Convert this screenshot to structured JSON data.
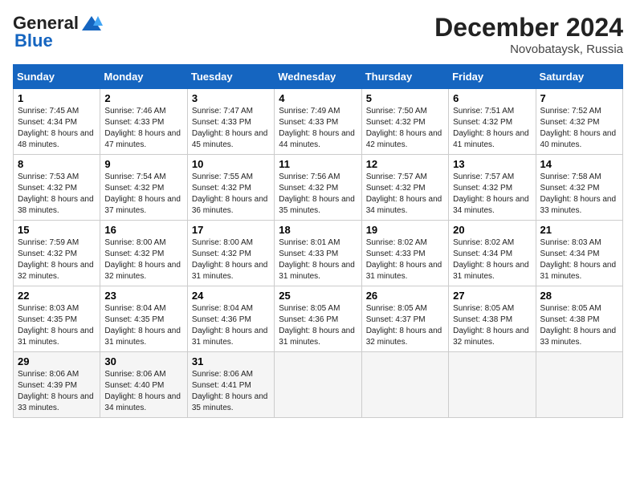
{
  "header": {
    "logo_general": "General",
    "logo_blue": "Blue",
    "month_title": "December 2024",
    "location": "Novobataysk, Russia"
  },
  "weekdays": [
    "Sunday",
    "Monday",
    "Tuesday",
    "Wednesday",
    "Thursday",
    "Friday",
    "Saturday"
  ],
  "weeks": [
    [
      {
        "day": "1",
        "sunrise": "Sunrise: 7:45 AM",
        "sunset": "Sunset: 4:34 PM",
        "daylight": "Daylight: 8 hours and 48 minutes."
      },
      {
        "day": "2",
        "sunrise": "Sunrise: 7:46 AM",
        "sunset": "Sunset: 4:33 PM",
        "daylight": "Daylight: 8 hours and 47 minutes."
      },
      {
        "day": "3",
        "sunrise": "Sunrise: 7:47 AM",
        "sunset": "Sunset: 4:33 PM",
        "daylight": "Daylight: 8 hours and 45 minutes."
      },
      {
        "day": "4",
        "sunrise": "Sunrise: 7:49 AM",
        "sunset": "Sunset: 4:33 PM",
        "daylight": "Daylight: 8 hours and 44 minutes."
      },
      {
        "day": "5",
        "sunrise": "Sunrise: 7:50 AM",
        "sunset": "Sunset: 4:32 PM",
        "daylight": "Daylight: 8 hours and 42 minutes."
      },
      {
        "day": "6",
        "sunrise": "Sunrise: 7:51 AM",
        "sunset": "Sunset: 4:32 PM",
        "daylight": "Daylight: 8 hours and 41 minutes."
      },
      {
        "day": "7",
        "sunrise": "Sunrise: 7:52 AM",
        "sunset": "Sunset: 4:32 PM",
        "daylight": "Daylight: 8 hours and 40 minutes."
      }
    ],
    [
      {
        "day": "8",
        "sunrise": "Sunrise: 7:53 AM",
        "sunset": "Sunset: 4:32 PM",
        "daylight": "Daylight: 8 hours and 38 minutes."
      },
      {
        "day": "9",
        "sunrise": "Sunrise: 7:54 AM",
        "sunset": "Sunset: 4:32 PM",
        "daylight": "Daylight: 8 hours and 37 minutes."
      },
      {
        "day": "10",
        "sunrise": "Sunrise: 7:55 AM",
        "sunset": "Sunset: 4:32 PM",
        "daylight": "Daylight: 8 hours and 36 minutes."
      },
      {
        "day": "11",
        "sunrise": "Sunrise: 7:56 AM",
        "sunset": "Sunset: 4:32 PM",
        "daylight": "Daylight: 8 hours and 35 minutes."
      },
      {
        "day": "12",
        "sunrise": "Sunrise: 7:57 AM",
        "sunset": "Sunset: 4:32 PM",
        "daylight": "Daylight: 8 hours and 34 minutes."
      },
      {
        "day": "13",
        "sunrise": "Sunrise: 7:57 AM",
        "sunset": "Sunset: 4:32 PM",
        "daylight": "Daylight: 8 hours and 34 minutes."
      },
      {
        "day": "14",
        "sunrise": "Sunrise: 7:58 AM",
        "sunset": "Sunset: 4:32 PM",
        "daylight": "Daylight: 8 hours and 33 minutes."
      }
    ],
    [
      {
        "day": "15",
        "sunrise": "Sunrise: 7:59 AM",
        "sunset": "Sunset: 4:32 PM",
        "daylight": "Daylight: 8 hours and 32 minutes."
      },
      {
        "day": "16",
        "sunrise": "Sunrise: 8:00 AM",
        "sunset": "Sunset: 4:32 PM",
        "daylight": "Daylight: 8 hours and 32 minutes."
      },
      {
        "day": "17",
        "sunrise": "Sunrise: 8:00 AM",
        "sunset": "Sunset: 4:32 PM",
        "daylight": "Daylight: 8 hours and 31 minutes."
      },
      {
        "day": "18",
        "sunrise": "Sunrise: 8:01 AM",
        "sunset": "Sunset: 4:33 PM",
        "daylight": "Daylight: 8 hours and 31 minutes."
      },
      {
        "day": "19",
        "sunrise": "Sunrise: 8:02 AM",
        "sunset": "Sunset: 4:33 PM",
        "daylight": "Daylight: 8 hours and 31 minutes."
      },
      {
        "day": "20",
        "sunrise": "Sunrise: 8:02 AM",
        "sunset": "Sunset: 4:34 PM",
        "daylight": "Daylight: 8 hours and 31 minutes."
      },
      {
        "day": "21",
        "sunrise": "Sunrise: 8:03 AM",
        "sunset": "Sunset: 4:34 PM",
        "daylight": "Daylight: 8 hours and 31 minutes."
      }
    ],
    [
      {
        "day": "22",
        "sunrise": "Sunrise: 8:03 AM",
        "sunset": "Sunset: 4:35 PM",
        "daylight": "Daylight: 8 hours and 31 minutes."
      },
      {
        "day": "23",
        "sunrise": "Sunrise: 8:04 AM",
        "sunset": "Sunset: 4:35 PM",
        "daylight": "Daylight: 8 hours and 31 minutes."
      },
      {
        "day": "24",
        "sunrise": "Sunrise: 8:04 AM",
        "sunset": "Sunset: 4:36 PM",
        "daylight": "Daylight: 8 hours and 31 minutes."
      },
      {
        "day": "25",
        "sunrise": "Sunrise: 8:05 AM",
        "sunset": "Sunset: 4:36 PM",
        "daylight": "Daylight: 8 hours and 31 minutes."
      },
      {
        "day": "26",
        "sunrise": "Sunrise: 8:05 AM",
        "sunset": "Sunset: 4:37 PM",
        "daylight": "Daylight: 8 hours and 32 minutes."
      },
      {
        "day": "27",
        "sunrise": "Sunrise: 8:05 AM",
        "sunset": "Sunset: 4:38 PM",
        "daylight": "Daylight: 8 hours and 32 minutes."
      },
      {
        "day": "28",
        "sunrise": "Sunrise: 8:05 AM",
        "sunset": "Sunset: 4:38 PM",
        "daylight": "Daylight: 8 hours and 33 minutes."
      }
    ],
    [
      {
        "day": "29",
        "sunrise": "Sunrise: 8:06 AM",
        "sunset": "Sunset: 4:39 PM",
        "daylight": "Daylight: 8 hours and 33 minutes."
      },
      {
        "day": "30",
        "sunrise": "Sunrise: 8:06 AM",
        "sunset": "Sunset: 4:40 PM",
        "daylight": "Daylight: 8 hours and 34 minutes."
      },
      {
        "day": "31",
        "sunrise": "Sunrise: 8:06 AM",
        "sunset": "Sunset: 4:41 PM",
        "daylight": "Daylight: 8 hours and 35 minutes."
      },
      null,
      null,
      null,
      null
    ]
  ]
}
